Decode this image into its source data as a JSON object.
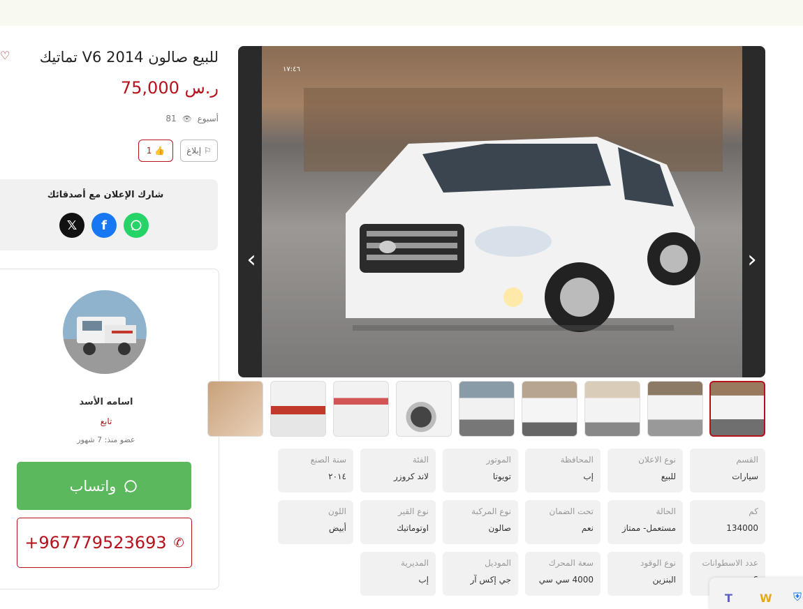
{
  "listing": {
    "title": "للبيع صالون 2014 V6 تماتيك",
    "price": "75,000 ر.س",
    "views": "81",
    "posted": "أسبوع",
    "report_label": "إبلاغ",
    "like_count": "1",
    "photo_time": "١٧:٤٦"
  },
  "share": {
    "title": "شارك الإعلان مع أصدقائك",
    "buttons": [
      "x-icon",
      "facebook-icon",
      "whatsapp-icon"
    ]
  },
  "seller": {
    "name": "اسامه الأسد",
    "follow_label": "تابع",
    "member_since": "عضو منذ: 7 شهور",
    "whatsapp_label": "واتساب",
    "phone": "+967779523693"
  },
  "specs": [
    {
      "key": "القسم",
      "value": "سيارات"
    },
    {
      "key": "نوع الاعلان",
      "value": "للبيع"
    },
    {
      "key": "المحافظة",
      "value": "إب"
    },
    {
      "key": "الموتور",
      "value": "تويوتا"
    },
    {
      "key": "الفئة",
      "value": "لاند كروزر"
    },
    {
      "key": "سنة الصنع",
      "value": "٢٠١٤"
    },
    {
      "key": "كم",
      "value": "134000"
    },
    {
      "key": "الحالة",
      "value": "مستعمل- ممتاز"
    },
    {
      "key": "تحت الضمان",
      "value": "نعم"
    },
    {
      "key": "نوع المركبة",
      "value": "صالون"
    },
    {
      "key": "نوع القير",
      "value": "اوتوماتيك"
    },
    {
      "key": "اللون",
      "value": "أبيض"
    },
    {
      "key": "عدد الاسطوانات",
      "value": "6"
    },
    {
      "key": "نوع الوقود",
      "value": "البنزين"
    },
    {
      "key": "سعة المحرك",
      "value": "4000 سي سي"
    },
    {
      "key": "الموديل",
      "value": "جي إكس آر"
    },
    {
      "key": "المديرية",
      "value": "إب"
    }
  ],
  "colors": {
    "accent": "#b5121b",
    "whatsapp": "#5cb85c",
    "facebook": "#1877f2",
    "x": "#111111"
  }
}
